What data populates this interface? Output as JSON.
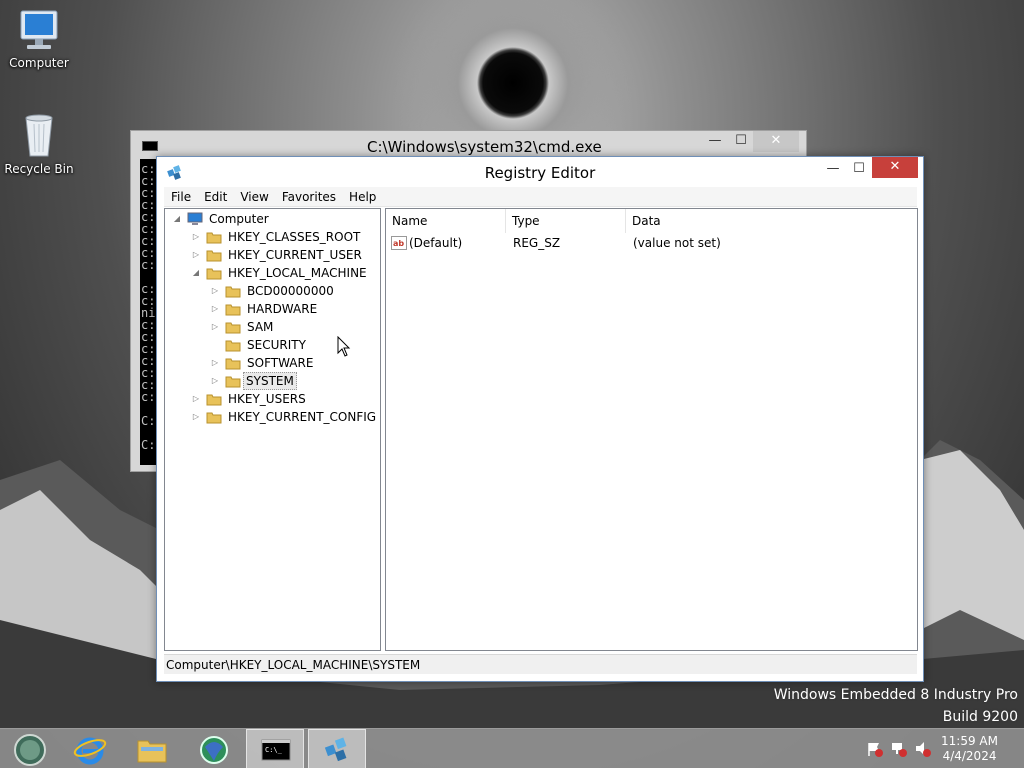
{
  "desktop": {
    "icons": [
      {
        "label": "Computer"
      },
      {
        "label": "Recycle Bin"
      }
    ],
    "watermark": {
      "line1": "Windows Embedded 8 Industry Pro",
      "line2": "Build 9200"
    }
  },
  "cmd_window": {
    "title": "C:\\Windows\\system32\\cmd.exe",
    "minimize": "—",
    "maximize": "☐",
    "close": "✕",
    "lines": [
      "c:",
      "c:",
      "c:",
      "c:",
      "c:",
      "c:",
      "c:",
      "c:",
      "c:",
      "",
      "c:",
      "c:",
      "ni",
      "c:",
      "c:",
      "c:",
      "c:",
      "c:",
      "c:",
      "c:",
      "",
      "C:",
      "",
      "C:"
    ]
  },
  "registry_editor": {
    "title": "Registry Editor",
    "minimize": "—",
    "maximize": "☐",
    "close": "✕",
    "menu": [
      "File",
      "Edit",
      "View",
      "Favorites",
      "Help"
    ],
    "tree": {
      "root": "Computer",
      "hives": [
        {
          "label": "HKEY_CLASSES_ROOT"
        },
        {
          "label": "HKEY_CURRENT_USER"
        },
        {
          "label": "HKEY_LOCAL_MACHINE"
        },
        {
          "label": "HKEY_USERS"
        },
        {
          "label": "HKEY_CURRENT_CONFIG"
        }
      ],
      "hklm_children": [
        {
          "label": "BCD00000000"
        },
        {
          "label": "HARDWARE"
        },
        {
          "label": "SAM"
        },
        {
          "label": "SECURITY"
        },
        {
          "label": "SOFTWARE"
        },
        {
          "label": "SYSTEM"
        }
      ],
      "expander_collapsed": "▷",
      "expander_expanded": "◢"
    },
    "columns": [
      "Name",
      "Type",
      "Data"
    ],
    "values": [
      {
        "name": "(Default)",
        "type": "REG_SZ",
        "data": "(value not set)"
      }
    ],
    "status_path": "Computer\\HKEY_LOCAL_MACHINE\\SYSTEM"
  },
  "taskbar": {
    "clock_time": "11:59 AM",
    "clock_date": "4/4/2024"
  },
  "colors": {
    "close_red": "#c7403b",
    "selection_gray": "#eaeaea",
    "folder_yellow": "#e8c25a"
  }
}
